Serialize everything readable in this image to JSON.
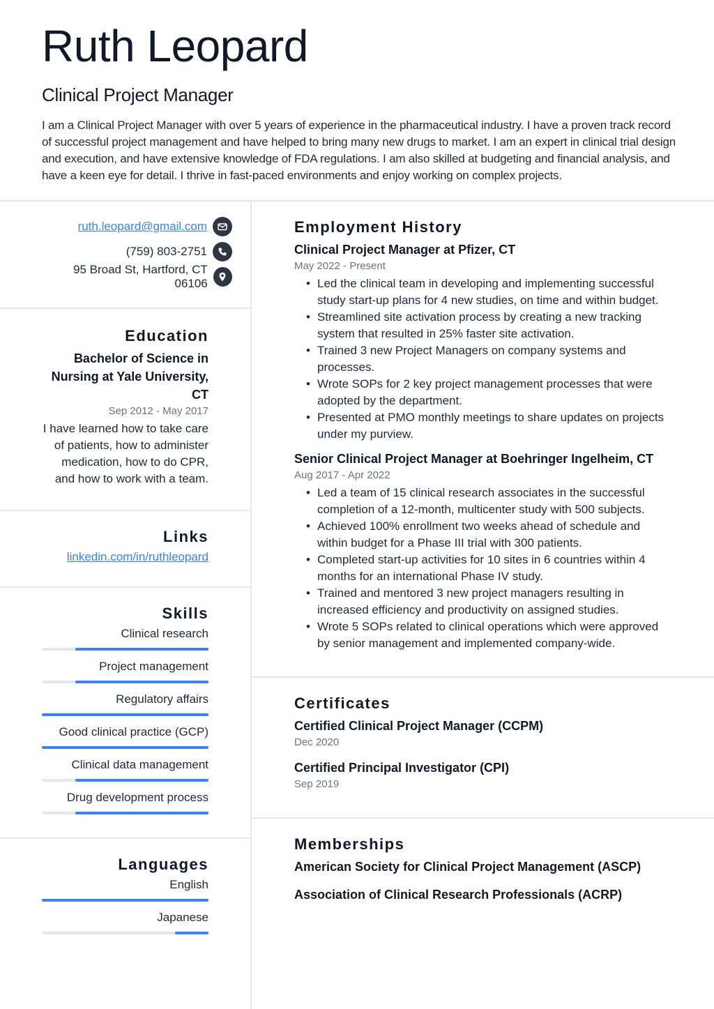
{
  "header": {
    "name": "Ruth Leopard",
    "title": "Clinical Project Manager",
    "summary": "I am a Clinical Project Manager with over 5 years of experience in the pharmaceutical industry. I have a proven track record of successful project management and have helped to bring many new drugs to market. I am an expert in clinical trial design and execution, and have extensive knowledge of FDA regulations. I am also skilled at budgeting and financial analysis, and have a keen eye for detail. I thrive in fast-paced environments and enjoy working on complex projects."
  },
  "contact": {
    "email": "ruth.leopard@gmail.com",
    "email_icon": "envelope-icon",
    "phone": "(759) 803-2751",
    "phone_icon": "phone-icon",
    "address": "95 Broad St, Hartford, CT 06106",
    "address_icon": "map-pin-icon"
  },
  "education": {
    "heading": "Education",
    "items": [
      {
        "title": "Bachelor of Science in Nursing at Yale University, CT",
        "dates": "Sep 2012 - May 2017",
        "description": "I have learned how to take care of patients, how to administer medication, how to do CPR, and how to work with a team."
      }
    ]
  },
  "links": {
    "heading": "Links",
    "items": [
      {
        "label": "linkedin.com/in/ruthleopard"
      }
    ]
  },
  "skills": {
    "heading": "Skills",
    "accent_color": "#3b82f6",
    "track_color": "#e5e7eb",
    "items": [
      {
        "label": "Clinical research",
        "level_percent": 80
      },
      {
        "label": "Project management",
        "level_percent": 80
      },
      {
        "label": "Regulatory affairs",
        "level_percent": 100
      },
      {
        "label": "Good clinical practice (GCP)",
        "level_percent": 100
      },
      {
        "label": "Clinical data management",
        "level_percent": 80
      },
      {
        "label": "Drug development process",
        "level_percent": 80
      }
    ]
  },
  "languages": {
    "heading": "Languages",
    "items": [
      {
        "label": "English",
        "level_percent": 100
      },
      {
        "label": "Japanese",
        "level_percent": 20
      }
    ]
  },
  "employment": {
    "heading": "Employment History",
    "jobs": [
      {
        "title": "Clinical Project Manager at Pfizer, CT",
        "dates": "May 2022 - Present",
        "bullets": [
          "Led the clinical team in developing and implementing successful study start-up plans for 4 new studies, on time and within budget.",
          "Streamlined site activation process by creating a new tracking system that resulted in 25% faster site activation.",
          "Trained 3 new Project Managers on company systems and processes.",
          "Wrote SOPs for 2 key project management processes that were adopted by the department.",
          "Presented at PMO monthly meetings to share updates on projects under my purview."
        ]
      },
      {
        "title": "Senior Clinical Project Manager at Boehringer Ingelheim, CT",
        "dates": "Aug 2017 - Apr 2022",
        "bullets": [
          "Led a team of 15 clinical research associates in the successful completion of a 12-month, multicenter study with 500 subjects.",
          "Achieved 100% enrollment two weeks ahead of schedule and within budget for a Phase III trial with 300 patients.",
          "Completed start-up activities for 10 sites in 6 countries within 4 months for an international Phase IV study.",
          "Trained and mentored 3 new project managers resulting in increased efficiency and productivity on assigned studies.",
          "Wrote 5 SOPs related to clinical operations which were approved by senior management and implemented company-wide."
        ]
      }
    ]
  },
  "certificates": {
    "heading": "Certificates",
    "items": [
      {
        "name": "Certified Clinical Project Manager (CCPM)",
        "date": "Dec 2020"
      },
      {
        "name": "Certified Principal Investigator (CPI)",
        "date": "Sep 2019"
      }
    ]
  },
  "memberships": {
    "heading": "Memberships",
    "items": [
      "American Society for Clinical Project Management (ASCP)",
      "Association of Clinical Research Professionals (ACRP)"
    ]
  }
}
